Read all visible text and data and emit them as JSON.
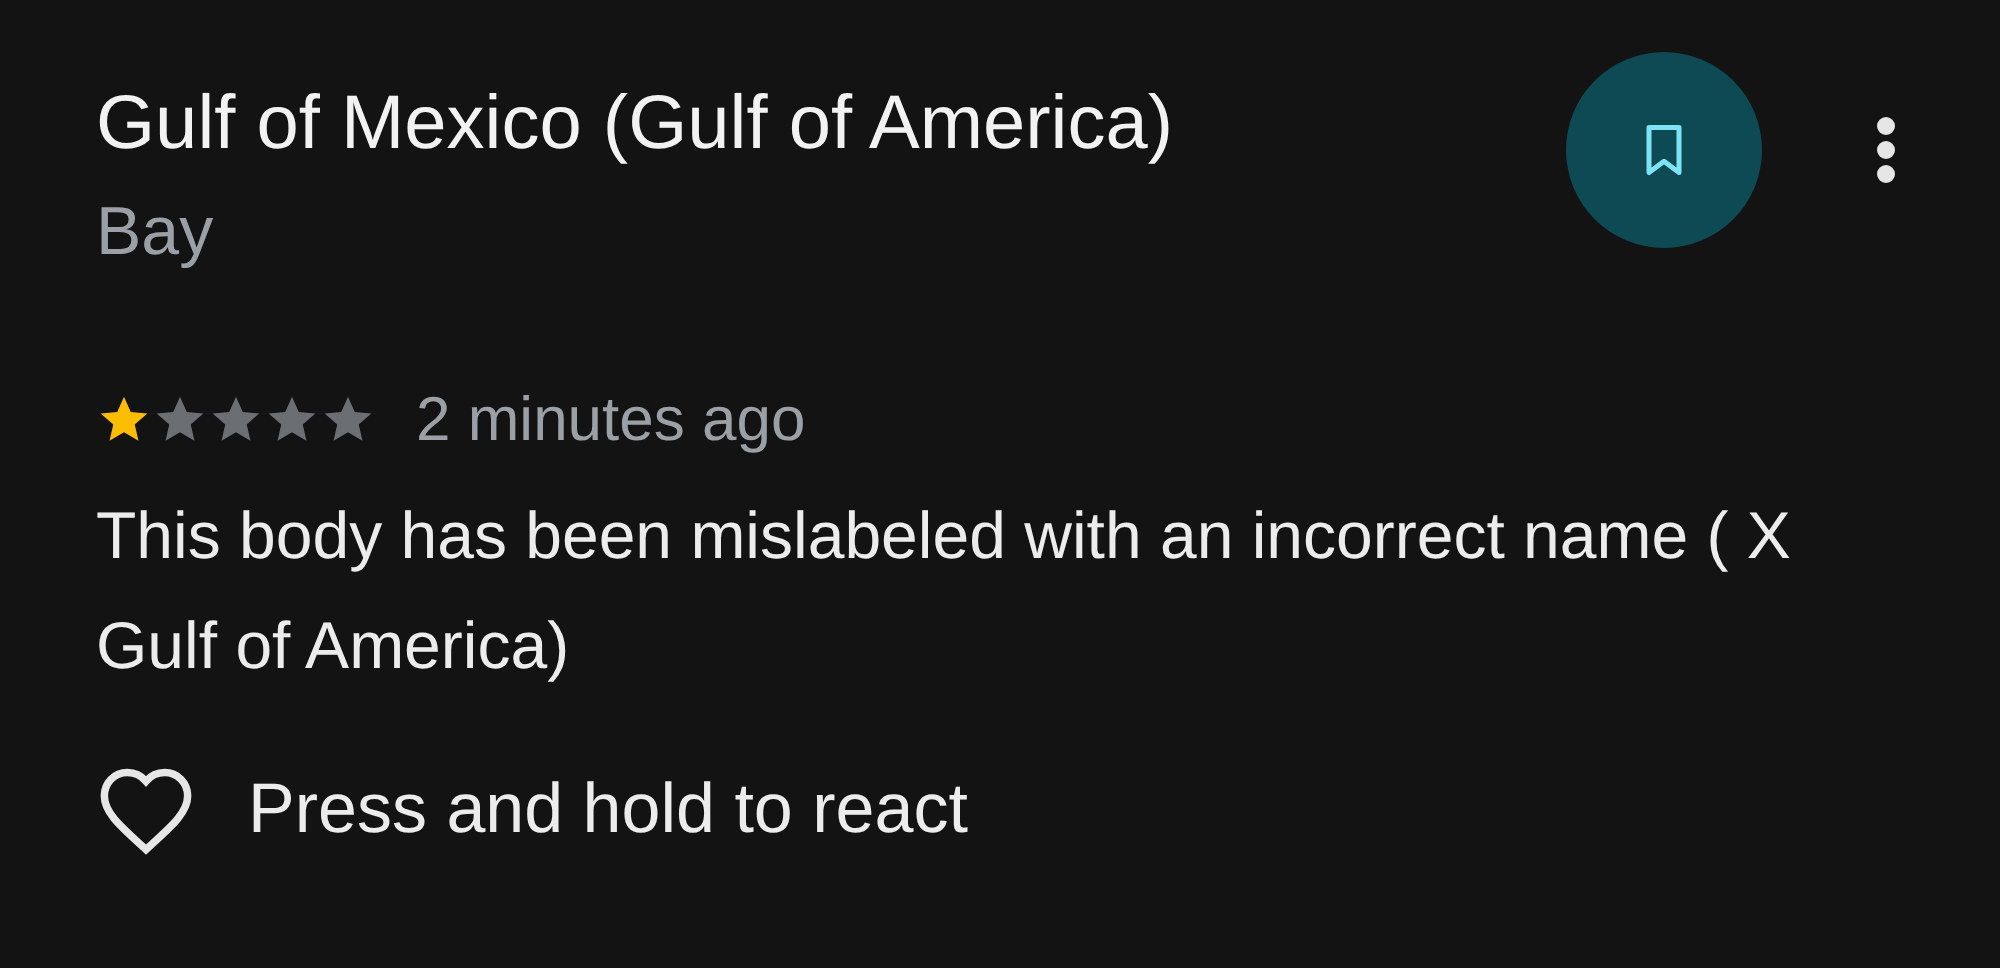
{
  "place": {
    "name": "Gulf of Mexico (Gulf of America)",
    "type": "Bay",
    "saved": false
  },
  "review": {
    "stars": 1,
    "time": "2 minutes ago",
    "text": "This body has been mislabeled with an incorrect name ( X Gulf of America)"
  },
  "reaction": {
    "label": "Press and hold to react"
  }
}
